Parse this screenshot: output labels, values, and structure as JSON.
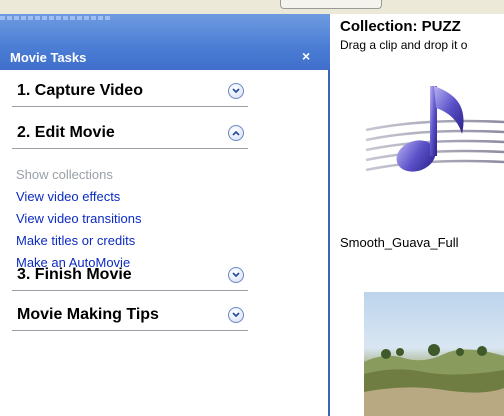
{
  "pane": {
    "title": "Movie Tasks",
    "close_glyph": "×",
    "sections": [
      {
        "label": "1. Capture Video",
        "state": "collapsed"
      },
      {
        "label": "2. Edit Movie",
        "state": "expanded"
      },
      {
        "label": "3. Finish Movie",
        "state": "collapsed"
      },
      {
        "label": "Movie Making Tips",
        "state": "collapsed"
      }
    ],
    "tasks": [
      {
        "label": "Show collections",
        "enabled": false
      },
      {
        "label": "View video effects",
        "enabled": true
      },
      {
        "label": "View video transitions",
        "enabled": true
      },
      {
        "label": "Make titles or credits",
        "enabled": true
      },
      {
        "label": "Make an AutoMovie",
        "enabled": true
      }
    ]
  },
  "collection": {
    "title": "Collection: PUZZ",
    "hint": "Drag a clip and drop it o",
    "items": [
      {
        "caption": "Smooth_Guava_Full",
        "icon": "music-note-icon"
      },
      {
        "caption": "",
        "icon": "landscape-video-thumbnail"
      }
    ]
  },
  "colors": {
    "pane_header": "#4d7fd6",
    "task_link": "#0c2bc3",
    "task_disabled": "#9aa0a6"
  }
}
